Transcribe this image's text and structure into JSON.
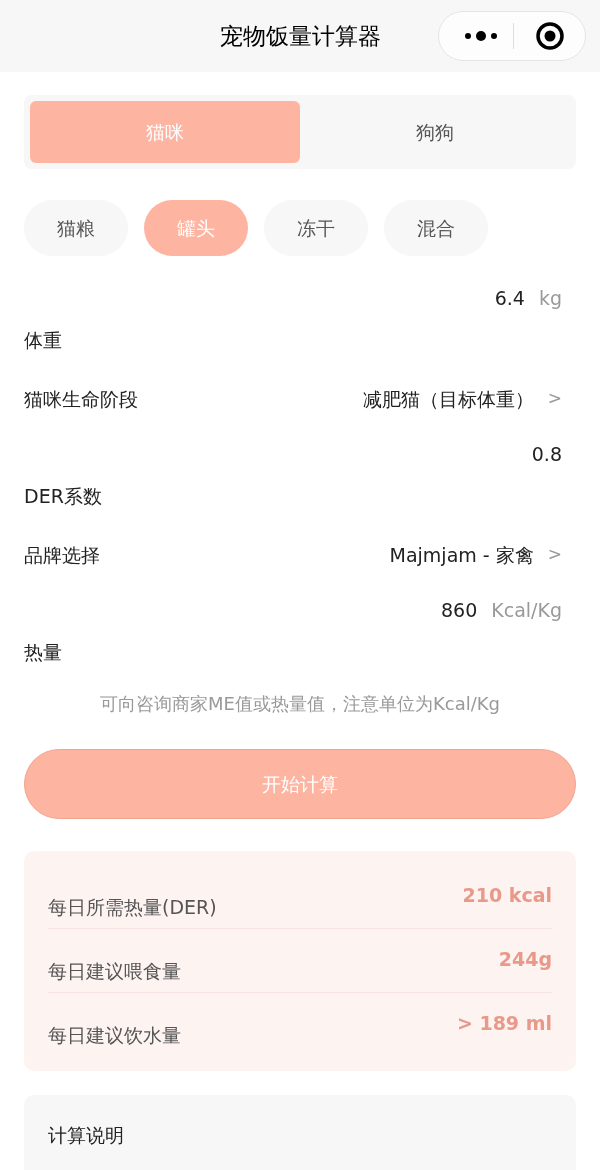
{
  "nav_bar": {
    "title": "宠物饭量计算器"
  },
  "pet_tabs": [
    {
      "label": "猫咪",
      "selected": true
    },
    {
      "label": "狗狗",
      "selected": false
    }
  ],
  "food_types": [
    {
      "label": "猫粮",
      "selected": false
    },
    {
      "label": "罐头",
      "selected": true
    },
    {
      "label": "冻干",
      "selected": false
    },
    {
      "label": "混合",
      "selected": false
    }
  ],
  "fields": [
    {
      "kind": "input",
      "label": "体重",
      "value": "6.4",
      "unit": "kg"
    },
    {
      "kind": "picker",
      "label": "猫咪生命阶段",
      "value": "减肥猫（目标体重）",
      "chevron": ">"
    },
    {
      "kind": "input",
      "label": "DER系数",
      "value": "0.8"
    },
    {
      "kind": "picker",
      "label": "品牌选择",
      "value": "Majmjam - 家禽",
      "chevron": ">"
    },
    {
      "kind": "input",
      "label": "热量",
      "value": "860",
      "unit": "Kcal/Kg"
    }
  ],
  "hint": "可向咨询商家ME值或热量值，注意单位为Kcal/Kg",
  "calculate_button": "开始计算",
  "results": [
    {
      "label": "每日所需热量(DER)",
      "value": "210 kcal"
    },
    {
      "label": "每日建议喂食量",
      "value": "244g"
    },
    {
      "label": "每日建议饮水量",
      "value": "> 189 ml"
    }
  ],
  "explanation": {
    "title": "计算说明"
  }
}
